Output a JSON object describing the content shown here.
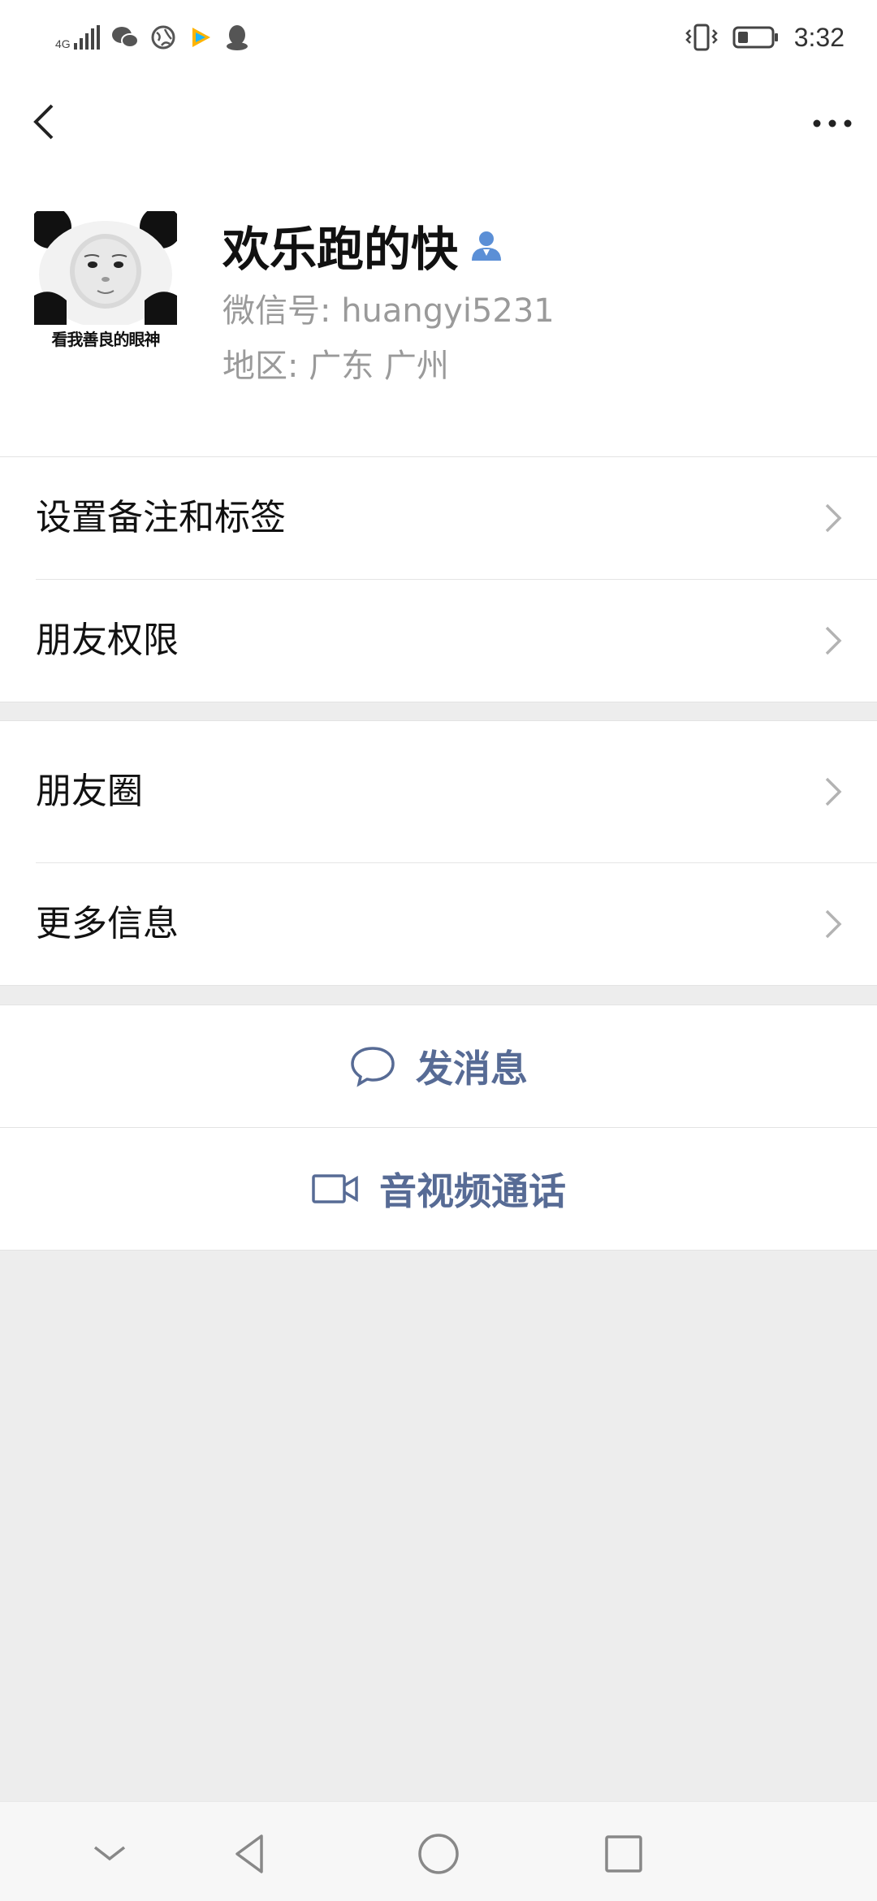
{
  "status_bar": {
    "network": "4G",
    "time": "3:32",
    "icons": [
      "signal-icon",
      "wechat-icon",
      "browser-icon",
      "video-app-icon",
      "qq-icon",
      "vibrate-icon",
      "battery-icon"
    ]
  },
  "nav": {
    "back_icon": "chevron-left-icon",
    "more_icon": "ellipsis-icon"
  },
  "profile": {
    "avatar_caption": "看我善良的眼神",
    "name": "欢乐跑的快",
    "wechat_id": "微信号: huangyi5231",
    "region": "地区: 广东  广州",
    "badge_color": "#5b8fd6"
  },
  "menu_group_1": [
    {
      "label": "设置备注和标签"
    },
    {
      "label": "朋友权限"
    }
  ],
  "menu_group_2": [
    {
      "label": "朋友圈"
    },
    {
      "label": "更多信息"
    }
  ],
  "actions": {
    "message_label": "发消息",
    "call_label": "音视频通话",
    "accent_color": "#576b95"
  },
  "system_nav": [
    "collapse-icon",
    "back-triangle-icon",
    "home-circle-icon",
    "recents-square-icon"
  ]
}
